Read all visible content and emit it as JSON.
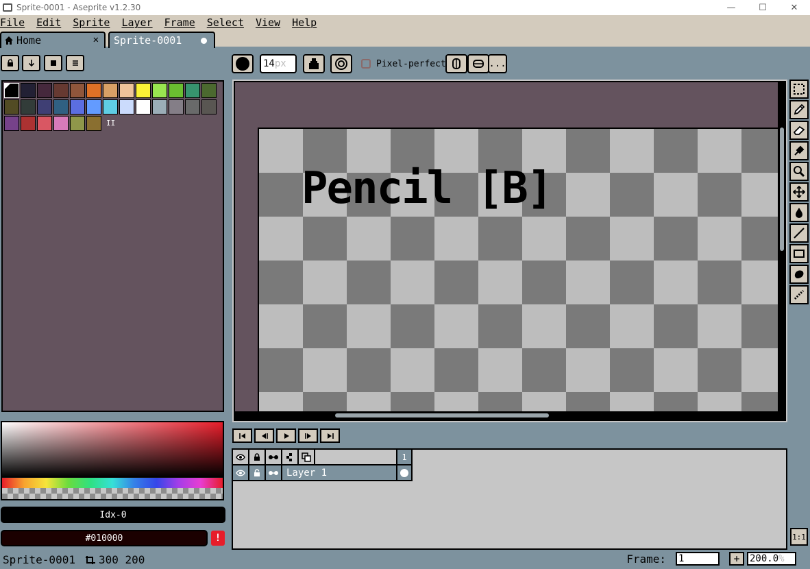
{
  "window": {
    "title": "Sprite-0001 - Aseprite v1.2.30",
    "controls": [
      "—",
      "☐",
      "✕"
    ]
  },
  "menubar": [
    "File",
    "Edit",
    "Sprite",
    "Layer",
    "Frame",
    "Select",
    "View",
    "Help"
  ],
  "tabs": [
    {
      "label": "Home",
      "icon": "home-icon",
      "close": "✕"
    },
    {
      "label": "Sprite-0001",
      "modified": true
    }
  ],
  "palette_toolbar": [
    "lock-icon",
    "arrow-down-icon",
    "stop-icon",
    "menu-icon"
  ],
  "tool_options": {
    "brush_size": "14",
    "brush_unit": "px",
    "pixel_perfect_label": "Pixel-perfect",
    "pixel_perfect_checked": false,
    "more_label": "..."
  },
  "palette": {
    "colors": [
      "#000000",
      "#222034",
      "#45283c",
      "#663931",
      "#8f563b",
      "#df7126",
      "#d9a066",
      "#eec39a",
      "#fbf236",
      "#99e550",
      "#6abe30",
      "#37946e",
      "#4b692f",
      "#524b24",
      "#323c39",
      "#3f3f74",
      "#306082",
      "#5b6ee1",
      "#639bff",
      "#5fcde4",
      "#cbdbfc",
      "#ffffff",
      "#9badb7",
      "#847e87",
      "#696a6a",
      "#595652",
      "#76428a",
      "#ac3232",
      "#d95763",
      "#d77bba",
      "#8f974a",
      "#8a6f30"
    ],
    "paren_label": "II"
  },
  "color_bar": {
    "index_label": "Idx-0",
    "hex_label": "#010000",
    "warning": "!"
  },
  "editor": {
    "tooltip_text": "Pencil [B]"
  },
  "right_tools": [
    "rectangular-marquee-icon",
    "pencil-icon",
    "eraser-icon",
    "eyedropper-icon",
    "zoom-icon",
    "move-icon",
    "paint-bucket-icon",
    "line-icon",
    "rectangle-icon",
    "contour-icon",
    "blur-icon"
  ],
  "playback": [
    "first-frame-icon",
    "prev-frame-icon",
    "play-icon",
    "next-frame-icon",
    "last-frame-icon"
  ],
  "timeline": {
    "frame_header": "1",
    "layers": [
      {
        "name": "Layer 1"
      }
    ]
  },
  "statusbar": {
    "sprite_name": "Sprite-0001",
    "size": "300 200",
    "frame_label": "Frame:",
    "frame_value": "1",
    "add_frame": "+",
    "zoom": "200.0",
    "zoom_unit": "%",
    "zoom_button": "1:1"
  }
}
